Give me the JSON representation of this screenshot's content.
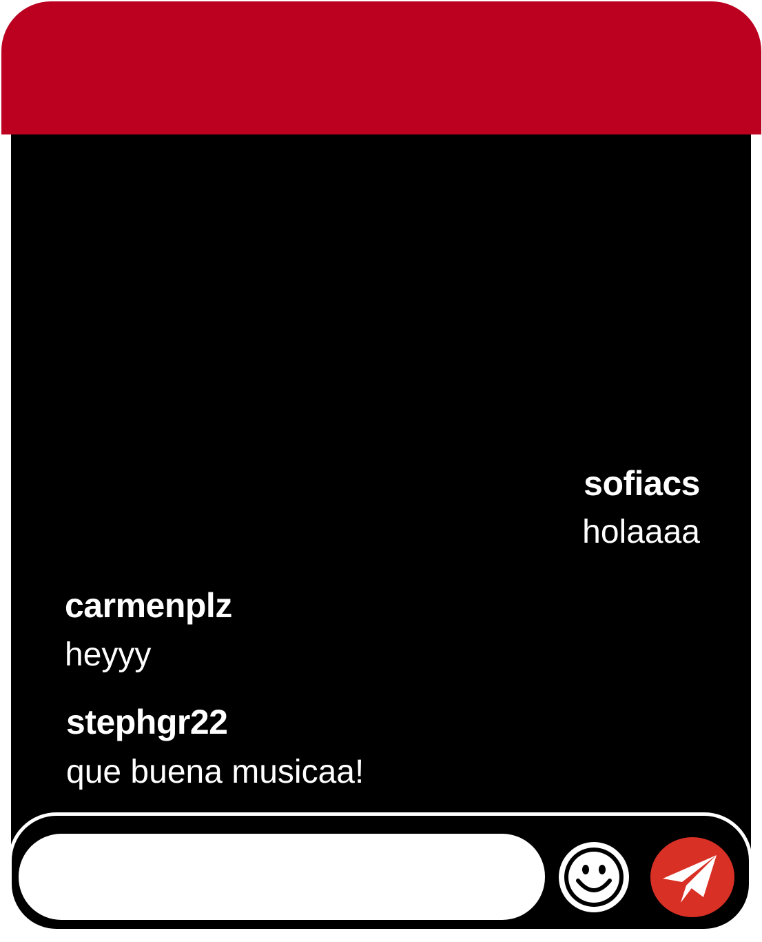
{
  "colors": {
    "header": "#bb0020",
    "chat_background": "#000000",
    "message_text": "#ffffff",
    "send_button": "#d93025"
  },
  "messages": [
    {
      "user": "sofiacs",
      "text": "holaaaa",
      "align": "right"
    },
    {
      "user": "carmenplz",
      "text": "heyyy",
      "align": "left"
    },
    {
      "user": "stephgr22",
      "text": "que buena musicaa!",
      "align": "left"
    }
  ],
  "composer": {
    "value": "",
    "emoji_icon": "smiley-face-icon",
    "send_icon": "paper-plane-icon"
  }
}
